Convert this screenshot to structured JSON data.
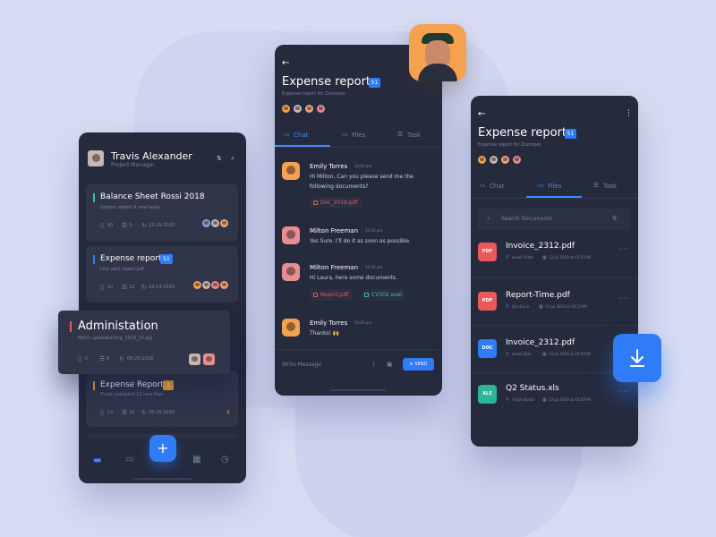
{
  "colors": {
    "background": "#d7dcf3",
    "panel": "#252a3d",
    "card": "#30354a",
    "accent": "#2f7cf6",
    "pdf": "#ea5a5a",
    "doc": "#2f7cf6",
    "xls": "#2bb796",
    "orange": "#f5a623"
  },
  "left": {
    "user_name": "Travis Alexander",
    "user_role": "Project Manager",
    "cards": [
      {
        "title": "Balance Sheet Rossi 2018",
        "subtitle": "Gordon added 4 new tasks",
        "files": "80",
        "tasks": "3",
        "date": "12-26-2018",
        "accent": "#37c3a5"
      },
      {
        "title": "Expense report",
        "badge": "51",
        "subtitle": "Lilly sent report.pdf",
        "files": "10",
        "tasks": "12",
        "date": "03-14-2018",
        "accent": "#2f7cf6"
      },
      {
        "title": "Administation",
        "subtitle": "Mario uploaded Img_2323_23.jpg",
        "files": "5",
        "tasks": "8",
        "date": "08-26-2018",
        "accent": "#ea5a5a"
      },
      {
        "title": "Expense Report",
        "badge": "3",
        "subtitle": "Frank uploaded 12 new files",
        "files": "12",
        "tasks": "10",
        "date": "08-26-2018",
        "accent": "#f5a623"
      }
    ],
    "fab": "+"
  },
  "chat": {
    "title": "Expense report",
    "badge": "51",
    "subtitle": "Expense report for Zoomper",
    "tabs": [
      "Chat",
      "Files",
      "Task"
    ],
    "messages": [
      {
        "name": "Emily Torres",
        "time": "10:02 pm",
        "lines": [
          "Hi Milton, Can you please send me the",
          "following documents?"
        ],
        "attachments": [
          {
            "name": "Doc_2019.pdf",
            "kind": "red"
          }
        ]
      },
      {
        "name": "Milton Freeman",
        "time": "10:02 pm",
        "lines": [
          "Yes Sure, I'll do it as soon as possible"
        ],
        "attachments": []
      },
      {
        "name": "Milton Freeman",
        "time": "10:02 pm",
        "lines": [
          "Hi Laura, here some documents."
        ],
        "attachments": [
          {
            "name": "Report.pdf",
            "kind": "red"
          },
          {
            "name": "CV302.exel",
            "kind": "green"
          }
        ]
      },
      {
        "name": "Emily Torres",
        "time": "10:02 pm",
        "lines": [
          "Thanks! 🙌"
        ],
        "attachments": []
      }
    ],
    "input_placeholder": "Write Message",
    "send_label": "SEND"
  },
  "files": {
    "title": "Expense report",
    "badge": "51",
    "subtitle": "Expense report for Zoomper",
    "tabs": [
      "Chat",
      "Files",
      "Task"
    ],
    "search_placeholder": "Search Documents",
    "items": [
      {
        "name": "Invoice_2312.pdf",
        "type": "PDF",
        "author": "Isaiah Scott",
        "date": "13 Jul 2019 at 03:57AM",
        "color": "#ea5a5a"
      },
      {
        "name": "Report-Time.pdf",
        "type": "PDF",
        "author": "Ora Dunn",
        "date": "13 Jul 2019 at 03:57AM",
        "color": "#ea5a5a"
      },
      {
        "name": "Invoice_2312.pdf",
        "type": "DOC",
        "author": "Sarah Diaz",
        "date": "13 Jul 2019 at 03:57AM",
        "color": "#2f7cf6"
      },
      {
        "name": "Q2 Status.xls",
        "type": "XLS",
        "author": "Virgie Barker",
        "date": "13 Jul 2019 at 03:57AM",
        "color": "#2bb796"
      }
    ]
  }
}
